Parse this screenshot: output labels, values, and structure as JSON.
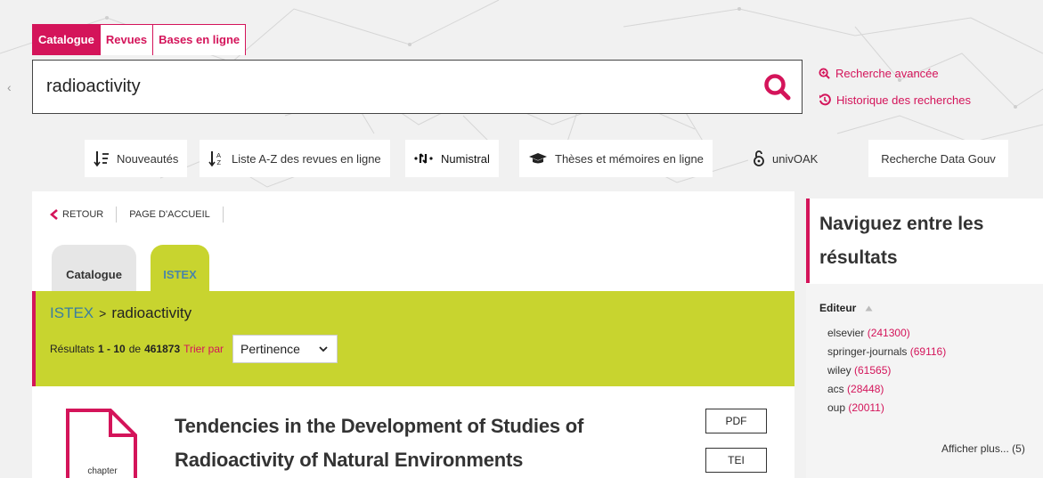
{
  "search": {
    "tabs": [
      "Catalogue",
      "Revues",
      "Bases en ligne"
    ],
    "query": "radioactivity",
    "advanced_link": "Recherche avancée",
    "history_link": "Historique des recherches"
  },
  "quick_nav": {
    "items": [
      "Nouveautés",
      "Liste A-Z des revues en ligne",
      "Numistral",
      "Thèses et mémoires en ligne",
      "univOAK",
      "Recherche Data Gouv"
    ]
  },
  "breadcrumb": {
    "back": "RETOUR",
    "home": "PAGE D'ACCUEIL"
  },
  "result_tabs": [
    "Catalogue",
    "ISTEX"
  ],
  "results_header": {
    "source": "ISTEX",
    "separator": ">",
    "query": "radioactivity",
    "prefix": "Résultats",
    "range": "1 - 10",
    "de": "de",
    "total": "461873",
    "sort_label": "Trier par",
    "sort_value": "Pertinence"
  },
  "result": {
    "type": "chapter",
    "title": "Tendencies in the Development of Studies of Radioactivity of Natural Environments",
    "formats": [
      "PDF",
      "TEI"
    ]
  },
  "sidebar": {
    "title": "Naviguez entre les résultats",
    "facet_title": "Editeur",
    "facet_items": [
      {
        "name": "elsevier",
        "count": "(241300)"
      },
      {
        "name": "springer-journals",
        "count": "(69116)"
      },
      {
        "name": "wiley",
        "count": "(61565)"
      },
      {
        "name": "acs",
        "count": "(28448)"
      },
      {
        "name": "oup",
        "count": "(20011)"
      }
    ],
    "more": "Afficher plus... (5)"
  },
  "colors": {
    "accent": "#d4145a",
    "istex_green": "#c8d42f",
    "istex_blue": "#3a7ea0"
  }
}
